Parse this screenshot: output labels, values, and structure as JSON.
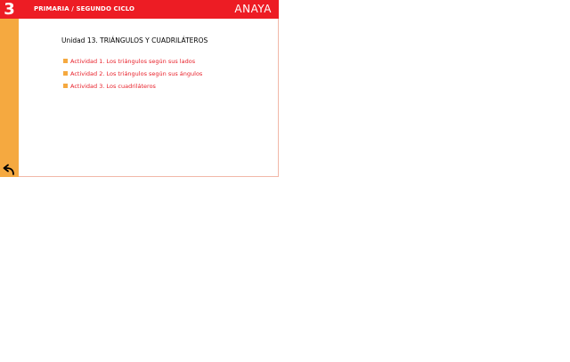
{
  "header": {
    "grade": "3",
    "title": "PRIMARIA / SEGUNDO CICLO",
    "logo": "ANAYA"
  },
  "main": {
    "unit_title": "Unidad 13. TRIÁNGULOS Y CUADRILÁTEROS",
    "activities": [
      {
        "label": "Actividad 1. Los triángulos según sus lados"
      },
      {
        "label": "Actividad 2. Los triángulos según sus ángulos"
      },
      {
        "label": "Actividad 3. Los cuadriláteros"
      }
    ]
  },
  "colors": {
    "header_red": "#ed1c24",
    "sidebar_orange": "#f5a940",
    "link_red": "#e8202a"
  },
  "icons": {
    "back": "back-arrow-icon"
  }
}
